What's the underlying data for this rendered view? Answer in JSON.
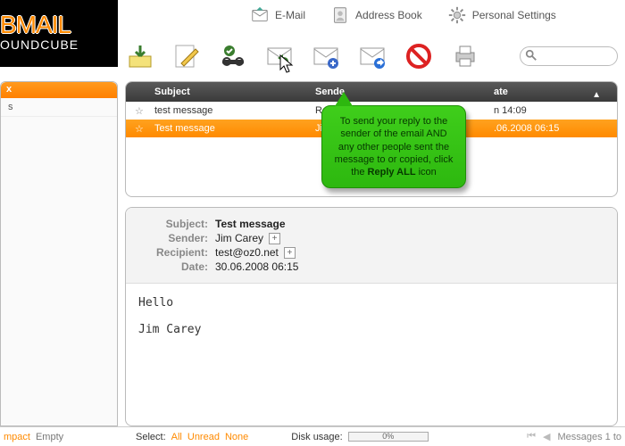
{
  "logo": {
    "line1": "BMAIL",
    "line2": "OUNDCUBE"
  },
  "topnav": {
    "email": "E-Mail",
    "addressbook": "Address Book",
    "settings": "Personal Settings"
  },
  "search": {
    "placeholder": ""
  },
  "folders": {
    "header": "x",
    "items": [
      "s"
    ]
  },
  "list": {
    "columns": {
      "subject": "Subject",
      "sender": "Sende",
      "date": "ate"
    },
    "sort_indicator": "▲",
    "rows": [
      {
        "star": "☆",
        "subject": "test message",
        "sender": "Rob M",
        "date": "n 14:09",
        "selected": false
      },
      {
        "star": "☆",
        "subject": "Test message",
        "sender": "Jim C",
        "date": ".06.2008 06:15",
        "selected": true
      }
    ]
  },
  "preview": {
    "labels": {
      "subject": "Subject:",
      "sender": "Sender:",
      "recipient": "Recipient:",
      "date": "Date:"
    },
    "subject": "Test message",
    "sender": "Jim Carey",
    "recipient": "test@oz0.net",
    "date": "30.06.2008 06:15",
    "body": "Hello\n\nJim Carey"
  },
  "status": {
    "left": {
      "mpact": "mpact",
      "empty": "Empty"
    },
    "select_label": "Select:",
    "select": {
      "all": "All",
      "unread": "Unread",
      "none": "None"
    },
    "disk_label": "Disk usage:",
    "disk_pct": "0%",
    "messages": "Messages 1 to"
  },
  "callout": {
    "pre": "To send your reply to the sender of the email AND any other people sent the message to or copied, click the ",
    "bold": "Reply ALL",
    "post": " icon"
  }
}
